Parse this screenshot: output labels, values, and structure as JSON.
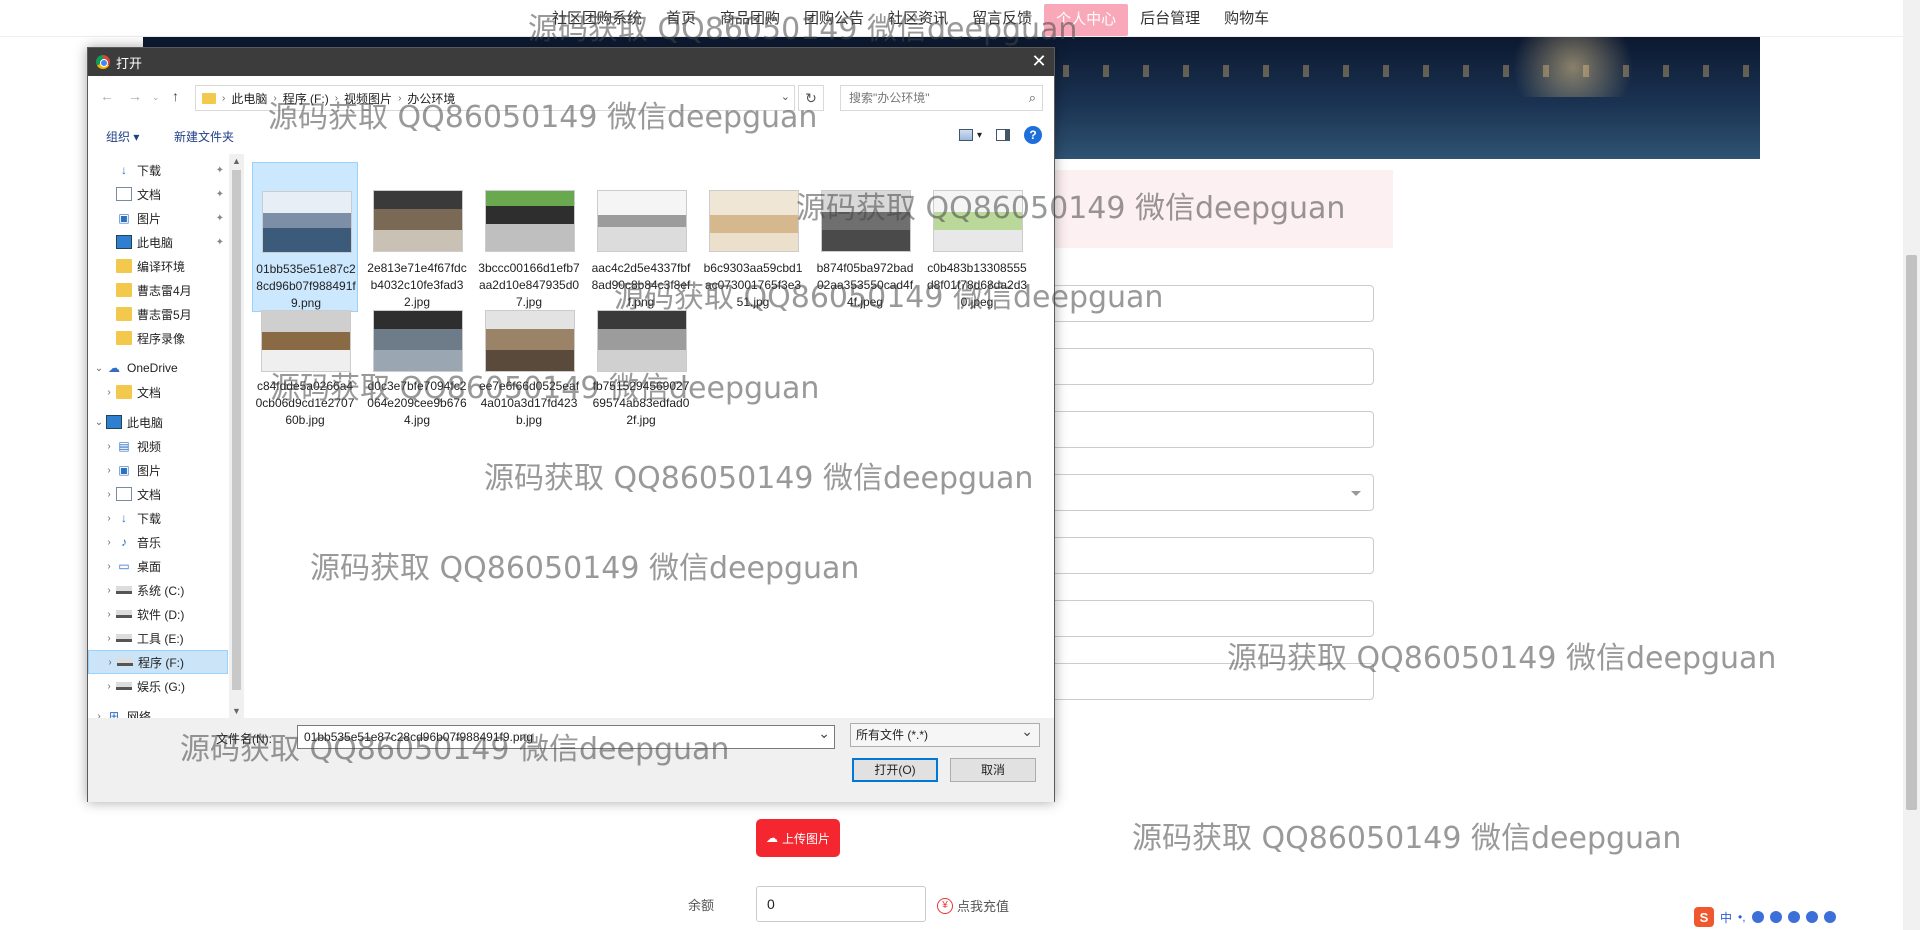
{
  "website": {
    "nav": [
      "社区团购系统",
      "首页",
      "商品团购",
      "团购公告",
      "社区资讯",
      "留言反馈",
      "个人中心",
      "后台管理",
      "购物车"
    ],
    "upload_button": "上传图片",
    "balance_label": "余额",
    "balance_value": "0",
    "recharge_label": "点我充值"
  },
  "dialog": {
    "title": "打开",
    "path": [
      "此电脑",
      "程序 (F:)",
      "视频图片",
      "办公环境"
    ],
    "search_placeholder": "搜索\"办公环境\"",
    "toolbar": {
      "organize": "组织 ▾",
      "new_folder": "新建文件夹"
    },
    "nav_items": [
      {
        "label": "下载",
        "icon": "download-icon",
        "pinned": true
      },
      {
        "label": "文档",
        "icon": "document-icon",
        "pinned": true
      },
      {
        "label": "图片",
        "icon": "picture-icon",
        "pinned": true
      },
      {
        "label": "此电脑",
        "icon": "computer-icon",
        "pinned": true
      },
      {
        "label": "编译环境",
        "icon": "folder-icon"
      },
      {
        "label": "曹志雷4月",
        "icon": "folder-icon"
      },
      {
        "label": "曹志雷5月",
        "icon": "folder-icon"
      },
      {
        "label": "程序录像",
        "icon": "folder-icon"
      },
      {
        "label": "OneDrive",
        "icon": "cloud-icon"
      },
      {
        "label": "文档",
        "icon": "folder-icon"
      },
      {
        "label": "此电脑",
        "icon": "computer-icon"
      },
      {
        "label": "视频",
        "icon": "video-icon"
      },
      {
        "label": "图片",
        "icon": "picture-icon"
      },
      {
        "label": "文档",
        "icon": "document-icon"
      },
      {
        "label": "下载",
        "icon": "download-icon"
      },
      {
        "label": "音乐",
        "icon": "music-icon"
      },
      {
        "label": "桌面",
        "icon": "desktop-icon"
      },
      {
        "label": "系统 (C:)",
        "icon": "drive-icon"
      },
      {
        "label": "软件 (D:)",
        "icon": "drive-icon"
      },
      {
        "label": "工具 (E:)",
        "icon": "drive-icon"
      },
      {
        "label": "程序 (F:)",
        "icon": "drive-icon"
      },
      {
        "label": "娱乐 (G:)",
        "icon": "drive-icon"
      },
      {
        "label": "网络",
        "icon": "network-icon"
      }
    ],
    "files": [
      "01bb535e51e87c28cd96b07f988491f9.png",
      "2e813e71e4f67fdcb4032c10fe3fad32.jpg",
      "3bccc00166d1efb7aa2d10e847935d07.jpg",
      "aac4c2d5e4337fbf8ad90c8b84c3f8eff.png",
      "b6c9303aa59cbd1ac073001765f3e351.jpg",
      "b874f05ba972bad02aa353550cad4f4f.jpeg",
      "c0b483b13308555d8f01f78d68da2d30.jpeg",
      "c84fdde5a0266a40cb06d9cd1e270760b.jpg",
      "d0c3e7bfe7094fc2064e209cee9b6764.jpg",
      "ee7e6f66d0525eaf4a010a3d17fd423b.jpg",
      "fb751529456902769574ab83edfad02f.jpg"
    ],
    "file_name_label": "文件名(N):",
    "file_name_value": "01bb535e51e87c28cd96b07f988491f9.png",
    "file_type": "所有文件 (*.*)",
    "open_button": "打开(O)",
    "cancel_button": "取消"
  },
  "watermark": "源码获取 QQ86050149 微信deepguan"
}
